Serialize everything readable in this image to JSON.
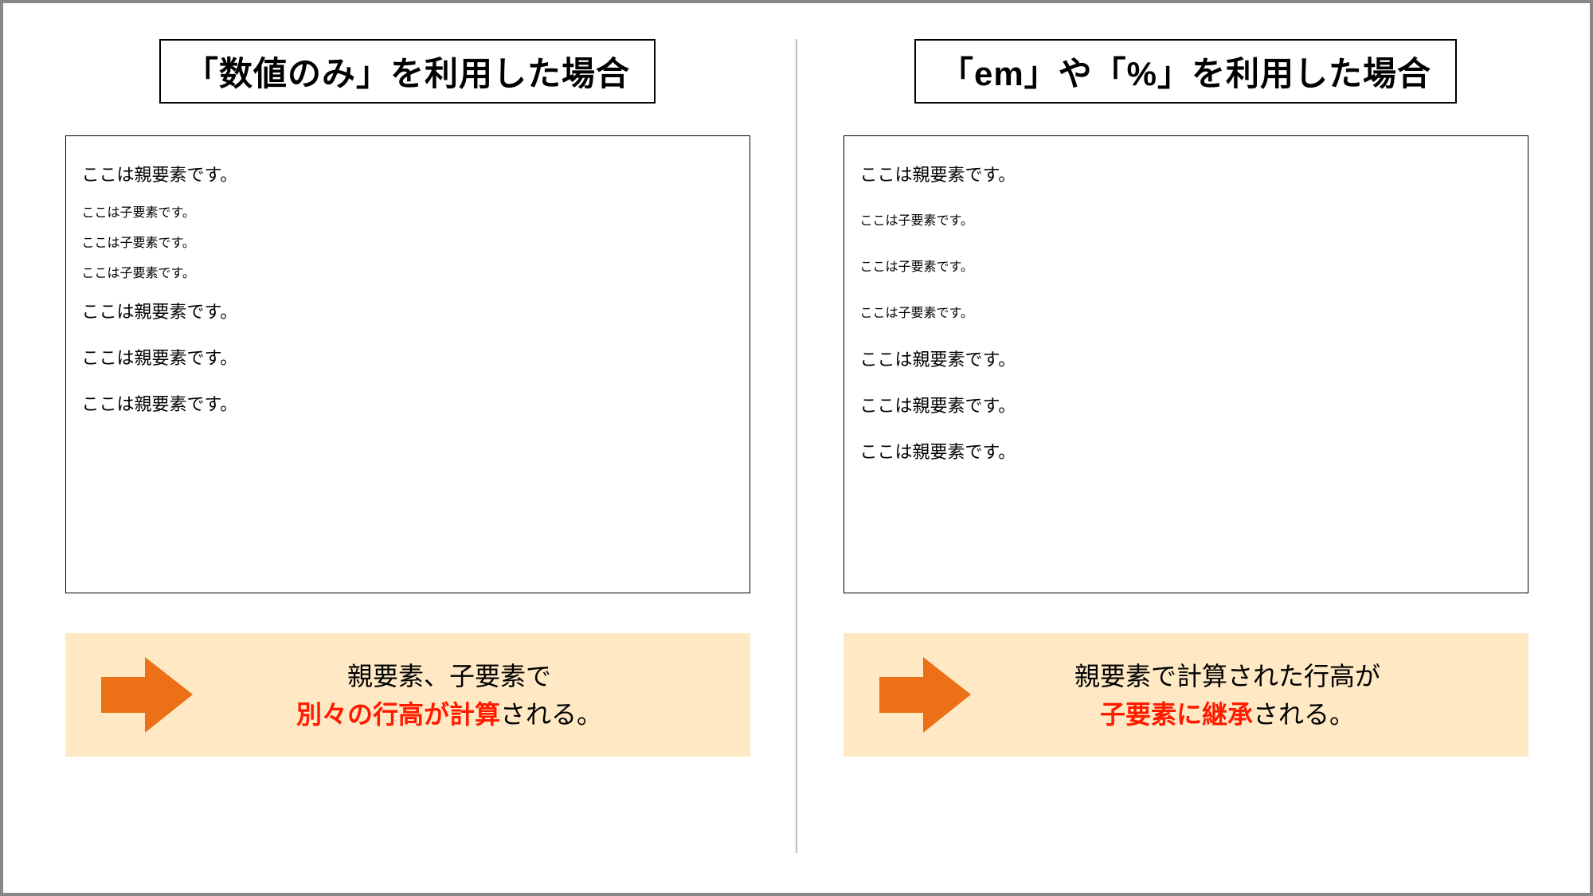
{
  "left": {
    "title": "「数値のみ」を利用した場合",
    "demo_lines": [
      {
        "kind": "parent",
        "text": "ここは親要素です。"
      },
      {
        "kind": "child",
        "text": "ここは子要素です。"
      },
      {
        "kind": "child",
        "text": "ここは子要素です。"
      },
      {
        "kind": "child",
        "text": "ここは子要素です。"
      },
      {
        "kind": "parent",
        "text": "ここは親要素です。"
      },
      {
        "kind": "parent",
        "text": "ここは親要素です。"
      },
      {
        "kind": "parent",
        "text": "ここは親要素です。"
      }
    ],
    "callout": {
      "line1_pre": "親要素、子要素で",
      "line2_em": "別々の行高が計算",
      "line2_post": "される。"
    }
  },
  "right": {
    "title": "「em」や「%」を利用した場合",
    "demo_lines": [
      {
        "kind": "parent",
        "text": "ここは親要素です。"
      },
      {
        "kind": "child",
        "text": "ここは子要素です。"
      },
      {
        "kind": "child",
        "text": "ここは子要素です。"
      },
      {
        "kind": "child",
        "text": "ここは子要素です。"
      },
      {
        "kind": "parent",
        "text": "ここは親要素です。"
      },
      {
        "kind": "parent",
        "text": "ここは親要素です。"
      },
      {
        "kind": "parent",
        "text": "ここは親要素です。"
      }
    ],
    "callout": {
      "line1_pre": "親要素で計算された行高が",
      "line2_em": "子要素に継承",
      "line2_post": "される。"
    }
  },
  "arrow_color": "#ec7016"
}
